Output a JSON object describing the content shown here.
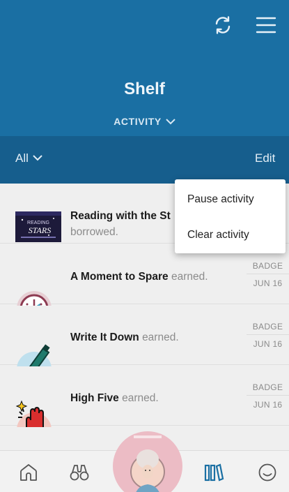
{
  "header": {
    "title": "Shelf",
    "dropdown_label": "ACTIVITY",
    "icons": [
      "sync-icon",
      "hamburger-menu-icon"
    ],
    "color": "#1a6fa3"
  },
  "filter_bar": {
    "filter_label": "All",
    "edit_label": "Edit",
    "color": "#165e8d"
  },
  "popup_menu": {
    "items": [
      {
        "label": "Pause activity"
      },
      {
        "label": "Clear activity"
      }
    ]
  },
  "activity_list": [
    {
      "title": "Reading with the St",
      "verb": "borrowed.",
      "icon": "book-cover-thumbnail",
      "thumb_text": [
        "READING",
        "STARS"
      ]
    },
    {
      "title": "A Moment to Spare",
      "verb": "earned.",
      "type": "BADGE",
      "date": "JUN 16",
      "icon": "clock-badge-icon"
    },
    {
      "title": "Write It Down",
      "verb": "earned.",
      "type": "BADGE",
      "date": "JUN 16",
      "icon": "pen-badge-icon"
    },
    {
      "title": "High Five",
      "verb": "earned.",
      "type": "BADGE",
      "date": "JUN 16",
      "icon": "high-five-badge-icon"
    }
  ],
  "bottom_nav": {
    "items": [
      "home-icon",
      "binoculars-icon",
      "current-book-cover",
      "shelf-books-icon",
      "smiley-icon"
    ],
    "active_color": "#1a6fa3"
  }
}
